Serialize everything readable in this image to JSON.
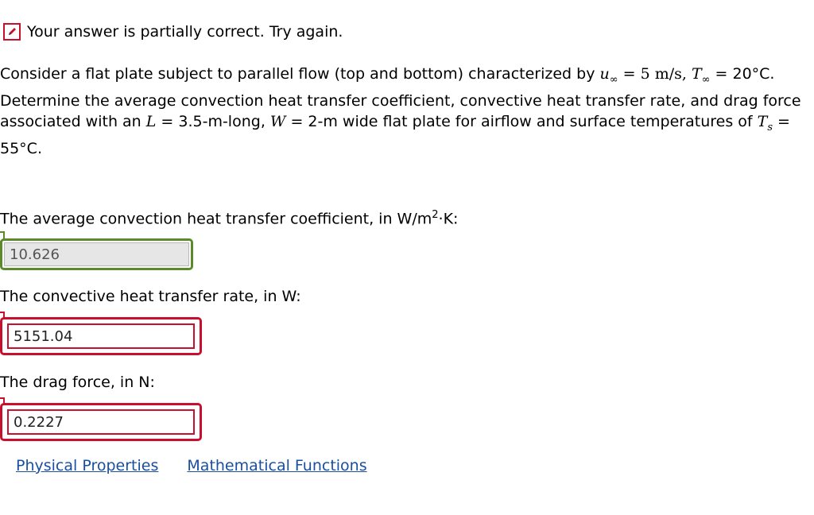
{
  "status": {
    "message": "Your answer is partially correct.  Try again.",
    "icon": "pencil-icon",
    "color": "#c8102e"
  },
  "problem": {
    "p1": "Consider a flat plate subject to parallel flow (top and bottom) characterized by ",
    "u_sym": "u",
    "inf": "∞",
    "eq1": " = 5 m/s, ",
    "T_sym": "T",
    "eq2": " =",
    "p2": " 20°C. Determine the average convection heat transfer coefficient, convective heat transfer rate, and drag force associated with an ",
    "L_sym": "L",
    "eq3": " = 3.5-m-long, ",
    "W_sym": "W",
    "eq4": " = 2-m wide flat plate for airflow and surface temperatures of ",
    "Ts_sym": "T",
    "s_sub": "s",
    "eq5": " = 55°C."
  },
  "questions": [
    {
      "label": "The average convection heat transfer coefficient, in W/m",
      "sup": "2",
      "label_tail": "·K:",
      "value": "10.626",
      "status": "correct"
    },
    {
      "label": "The convective heat transfer rate, in W:",
      "value": "5151.04",
      "status": "incorrect"
    },
    {
      "label": "The drag force, in N:",
      "value": "0.2227",
      "status": "incorrect"
    }
  ],
  "links": {
    "physical": "Physical Properties",
    "mathematical": "Mathematical Functions"
  },
  "colors": {
    "correct": "#5a8a2a",
    "incorrect": "#c8102e",
    "link": "#1a4fa0"
  }
}
